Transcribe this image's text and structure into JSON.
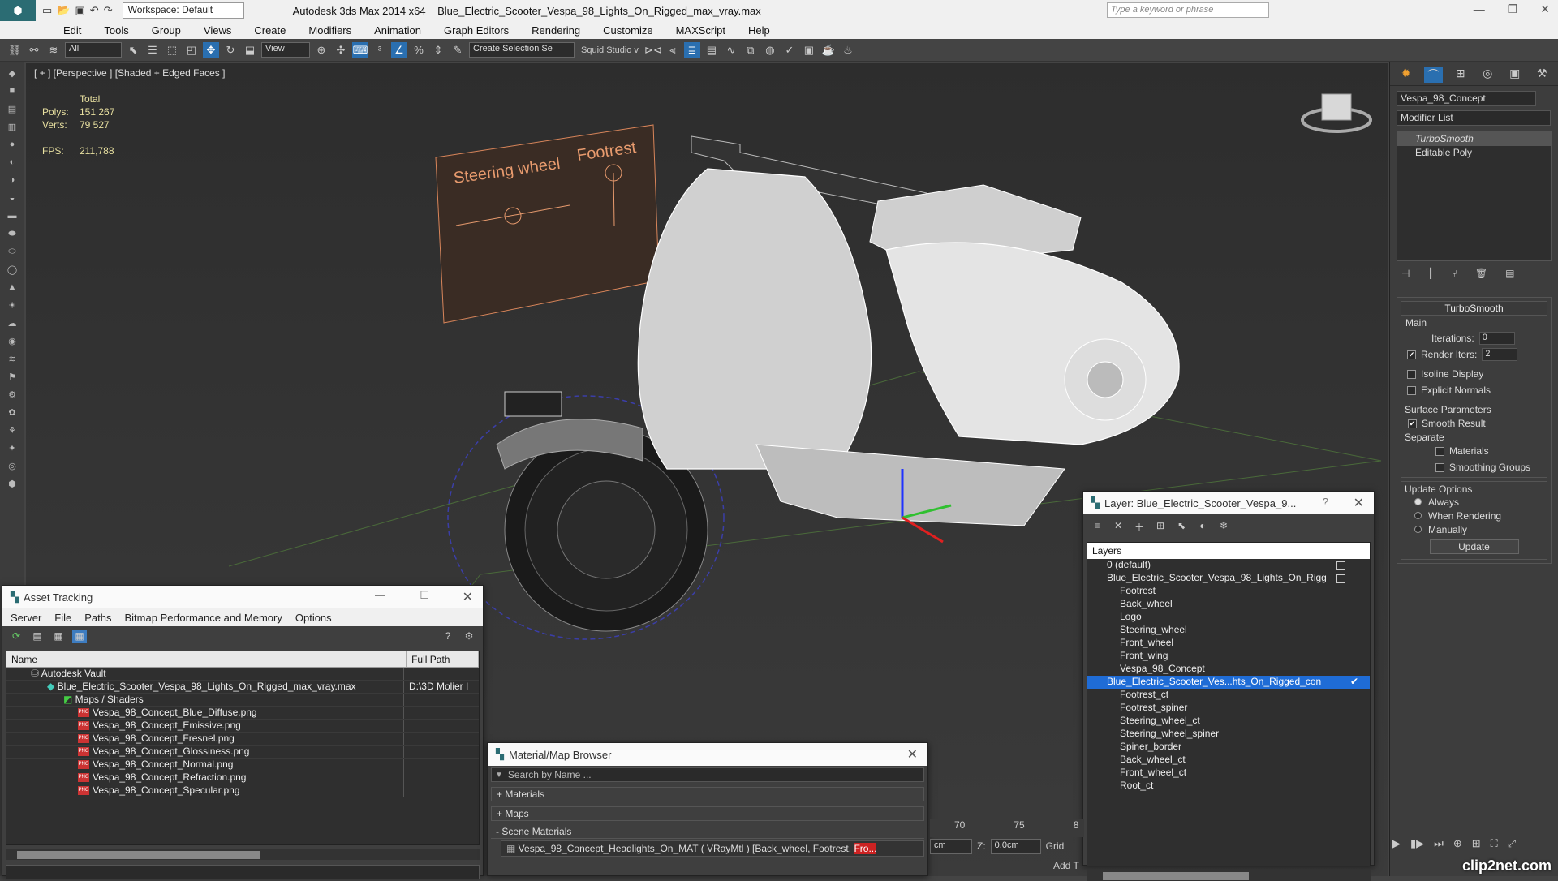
{
  "title_bar": {
    "workspace": "Workspace: Default",
    "app_title": "Autodesk 3ds Max  2014 x64",
    "file_title": "Blue_Electric_Scooter_Vespa_98_Lights_On_Rigged_max_vray.max",
    "search_placeholder": "Type a keyword or phrase"
  },
  "menu": [
    "Edit",
    "Tools",
    "Group",
    "Views",
    "Create",
    "Modifiers",
    "Animation",
    "Graph Editors",
    "Rendering",
    "Customize",
    "MAXScript",
    "Help"
  ],
  "toolbar": {
    "filter": "All",
    "coord": "View",
    "selection_set": "Create Selection Se",
    "squid": "Squid Studio v"
  },
  "viewport": {
    "label": "[ + ] [Perspective ] [Shaded + Edged Faces ]",
    "stats": {
      "total": "Total",
      "polys_label": "Polys:",
      "polys": "151 267",
      "verts_label": "Verts:",
      "verts": "79 527",
      "fps_label": "FPS:",
      "fps": "211,788"
    },
    "rig_labels": {
      "left": "Steering wheel",
      "right": "Footrest"
    }
  },
  "right_panel": {
    "object_name": "Vespa_98_Concept",
    "modifier_list": "Modifier List",
    "stack": [
      "TurboSmooth",
      "Editable Poly"
    ],
    "turbosmooth": {
      "title": "TurboSmooth",
      "main": "Main",
      "iterations_label": "Iterations:",
      "iterations": "0",
      "render_iters_label": "Render Iters:",
      "render_iters": "2",
      "isoline": "Isoline Display",
      "explicit": "Explicit Normals",
      "surface": "Surface Parameters",
      "smooth_result": "Smooth Result",
      "separate": "Separate",
      "materials": "Materials",
      "smoothing_groups": "Smoothing Groups",
      "update_options": "Update Options",
      "always": "Always",
      "when_rendering": "When Rendering",
      "manually": "Manually",
      "update": "Update"
    }
  },
  "asset_tracking": {
    "title": "Asset Tracking",
    "menu": [
      "Server",
      "File",
      "Paths",
      "Bitmap Performance and Memory",
      "Options"
    ],
    "col_name": "Name",
    "col_path": "Full Path",
    "rows": [
      {
        "name": "Autodesk Vault",
        "path": ""
      },
      {
        "name": "Blue_Electric_Scooter_Vespa_98_Lights_On_Rigged_max_vray.max",
        "path": "D:\\3D Molier I"
      },
      {
        "name": "Maps / Shaders",
        "path": ""
      },
      {
        "name": "Vespa_98_Concept_Blue_Diffuse.png",
        "path": ""
      },
      {
        "name": "Vespa_98_Concept_Emissive.png",
        "path": ""
      },
      {
        "name": "Vespa_98_Concept_Fresnel.png",
        "path": ""
      },
      {
        "name": "Vespa_98_Concept_Glossiness.png",
        "path": ""
      },
      {
        "name": "Vespa_98_Concept_Normal.png",
        "path": ""
      },
      {
        "name": "Vespa_98_Concept_Refraction.png",
        "path": ""
      },
      {
        "name": "Vespa_98_Concept_Specular.png",
        "path": ""
      }
    ]
  },
  "material_browser": {
    "title": "Material/Map Browser",
    "search": "Search by Name ...",
    "materials": "+ Materials",
    "maps": "+ Maps",
    "scene": "- Scene Materials",
    "item": "Vespa_98_Concept_Headlights_On_MAT ( VRayMtl ) [Back_wheel, Footrest,",
    "item_tail": "Fro..."
  },
  "layers": {
    "title": "Layer: Blue_Electric_Scooter_Vespa_9...",
    "help": "?",
    "header": "Layers",
    "items": [
      "0 (default)",
      "Blue_Electric_Scooter_Vespa_98_Lights_On_Rigg",
      "Footrest",
      "Back_wheel",
      "Logo",
      "Steering_wheel",
      "Front_wheel",
      "Front_wing",
      "Vespa_98_Concept",
      "Blue_Electric_Scooter_Ves...hts_On_Rigged_con",
      "Footrest_ct",
      "Footrest_spiner",
      "Steering_wheel_ct",
      "Steering_wheel_spiner",
      "Spiner_border",
      "Back_wheel_ct",
      "Front_wheel_ct",
      "Root_ct"
    ]
  },
  "timeline": {
    "ticks": [
      "70",
      "75",
      "8"
    ],
    "x_val": "cm",
    "z_label": "Z:",
    "z_val": "0,0cm",
    "grid": "Grid",
    "add": "Add T"
  },
  "watermark": "clip2net.com"
}
